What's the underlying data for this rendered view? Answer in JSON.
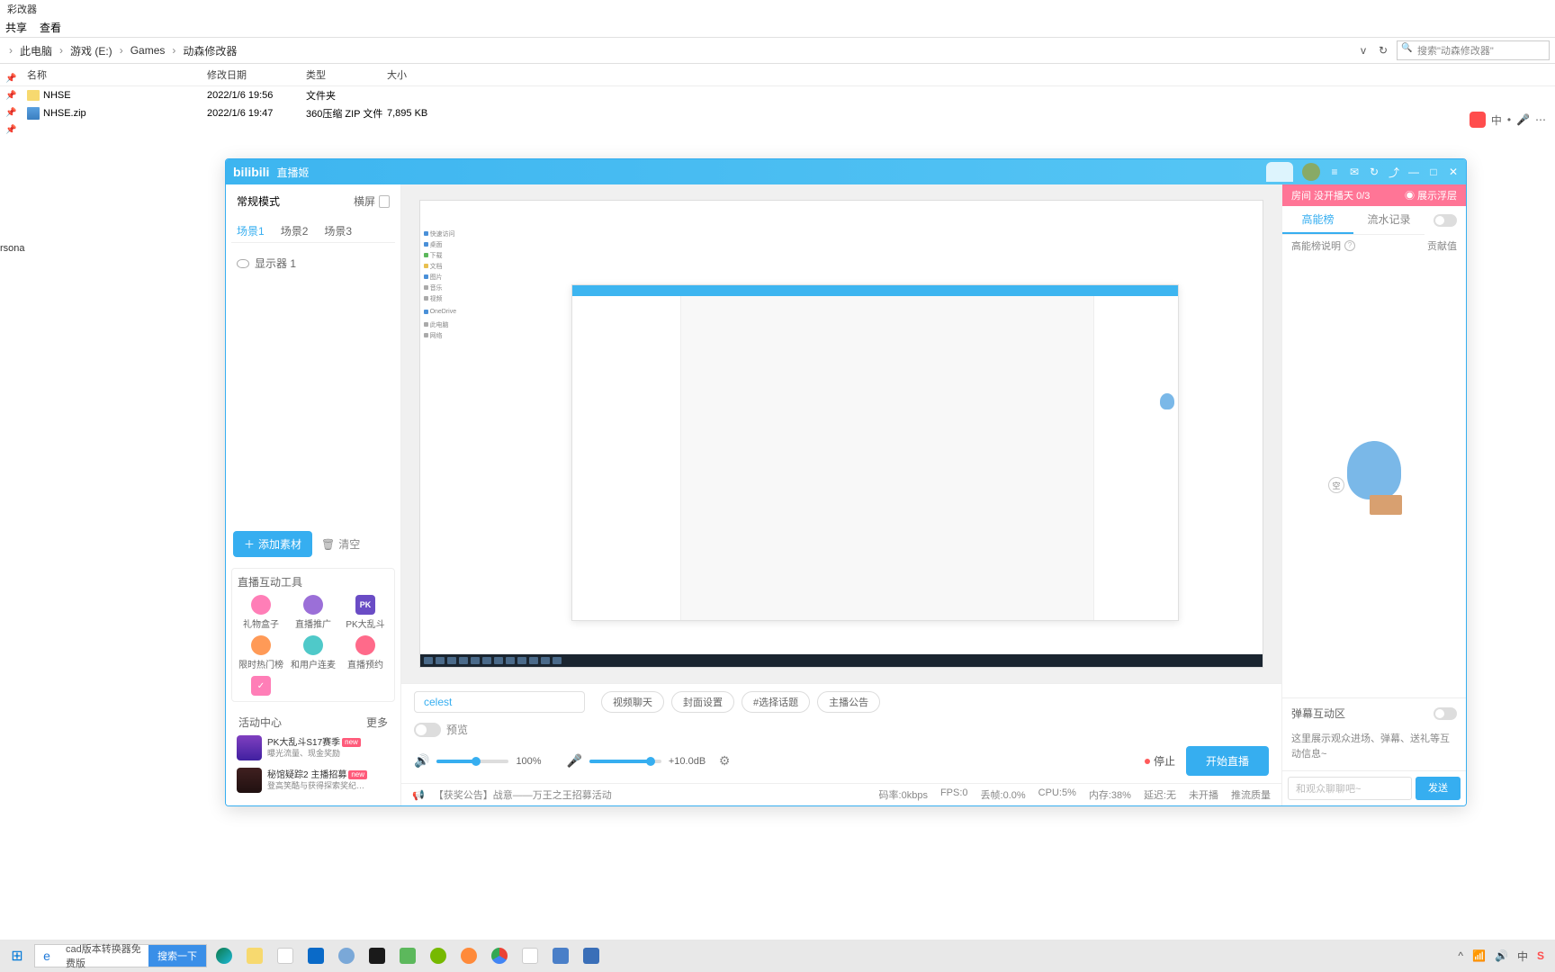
{
  "explorer": {
    "title": "彩改器",
    "menu": {
      "share": "共享",
      "view": "查看"
    },
    "breadcrumb": [
      "此电脑",
      "游戏 (E:)",
      "Games",
      "动森修改器"
    ],
    "path_dropdown": "v",
    "refresh": "↻",
    "search_placeholder": "搜索\"动森修改器\"",
    "headers": {
      "name": "名称",
      "date": "修改日期",
      "type": "类型",
      "size": "大小"
    },
    "rows": [
      {
        "name": "NHSE",
        "date": "2022/1/6 19:56",
        "type": "文件夹",
        "size": ""
      },
      {
        "name": "NHSE.zip",
        "date": "2022/1/6 19:47",
        "type": "360压缩 ZIP 文件",
        "size": "7,895 KB"
      }
    ],
    "personal": "rsona"
  },
  "ime": {
    "text1": "中",
    "text2": "•",
    "mic": "🎤",
    "more": "⋯"
  },
  "bili": {
    "logo": "bilibili",
    "title": "直播姬",
    "left": {
      "mode": "常规模式",
      "orient": "横屏",
      "scenes": {
        "s1": "场景1",
        "s2": "场景2",
        "s3": "场景3"
      },
      "display": "显示器 1",
      "add": "添加素材",
      "clear": "清空",
      "tools_title": "直播互动工具",
      "tools": {
        "t1": "礼物盒子",
        "t2": "直播推广",
        "t3": "PK大乱斗",
        "t4": "限时热门榜",
        "t5": "和用户连麦",
        "t6": "直播预约"
      },
      "activity_title": "活动中心",
      "activity_more": "更多",
      "activities": {
        "a1_title": "PK大乱斗S17赛季",
        "a1_sub": "曝光流量、现金奖励",
        "a2_title": "秘馆疑踪2 主播招募",
        "a2_sub": "登高笑酷与获得探索奖纪…",
        "new": "new"
      }
    },
    "controls": {
      "stream_title": "celest",
      "pills": {
        "p1": "视频聊天",
        "p2": "封面设置",
        "p3": "#选择话题",
        "p4": "主播公告"
      },
      "preview_label": "预览",
      "speaker_val": "100%",
      "mic_val": "+10.0dB",
      "stop": "停止",
      "start": "开始直播"
    },
    "status": {
      "announce": "【获奖公告】战意——万王之王招募活动",
      "bitrate": "码率:0kbps",
      "fps": "FPS:0",
      "drop": "丢帧:0.0%",
      "cpu": "CPU:5%",
      "mem": "内存:38%",
      "delay": "延迟:无",
      "nopush": "未开播",
      "pushq": "推流质量"
    },
    "right": {
      "top_left": "房间 没开播天 0/3",
      "top_right": "◉ 展示浮层",
      "tab1": "高能榜",
      "tab2": "流水记录",
      "sub_left": "高能榜说明",
      "sub_right": "贡献值",
      "speech": "空",
      "danmu_title": "弹幕互动区",
      "danmu_desc": "这里展示观众进场、弹幕、送礼等互动信息~",
      "send_placeholder": "和观众聊聊吧~",
      "send_btn": "发送"
    }
  },
  "taskbar": {
    "search_text": "cad版本转换器免费版",
    "search_btn": "搜索一下",
    "tray": {
      "ime": "中",
      "sogou": "S"
    }
  }
}
